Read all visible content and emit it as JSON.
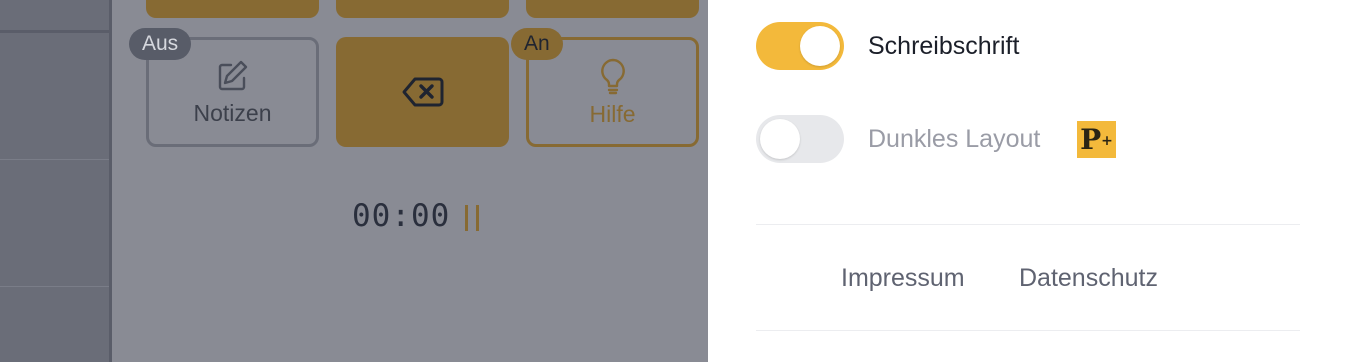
{
  "keypad": {
    "notes_button": {
      "label": "Notizen",
      "badge": "Aus"
    },
    "hint_button": {
      "label": "Hilfe",
      "badge": "An"
    }
  },
  "timer": {
    "value": "00:00"
  },
  "settings": {
    "cursive": {
      "label": "Schreibschrift",
      "enabled": true
    },
    "dark_layout": {
      "label": "Dunkles Layout",
      "enabled": false,
      "premium_badge": "P+"
    }
  },
  "footer": {
    "imprint": "Impressum",
    "privacy": "Datenschutz"
  },
  "colors": {
    "accent": "#f3b93b",
    "accent_dimmed": "#876a33",
    "overlay": "#898b94"
  }
}
